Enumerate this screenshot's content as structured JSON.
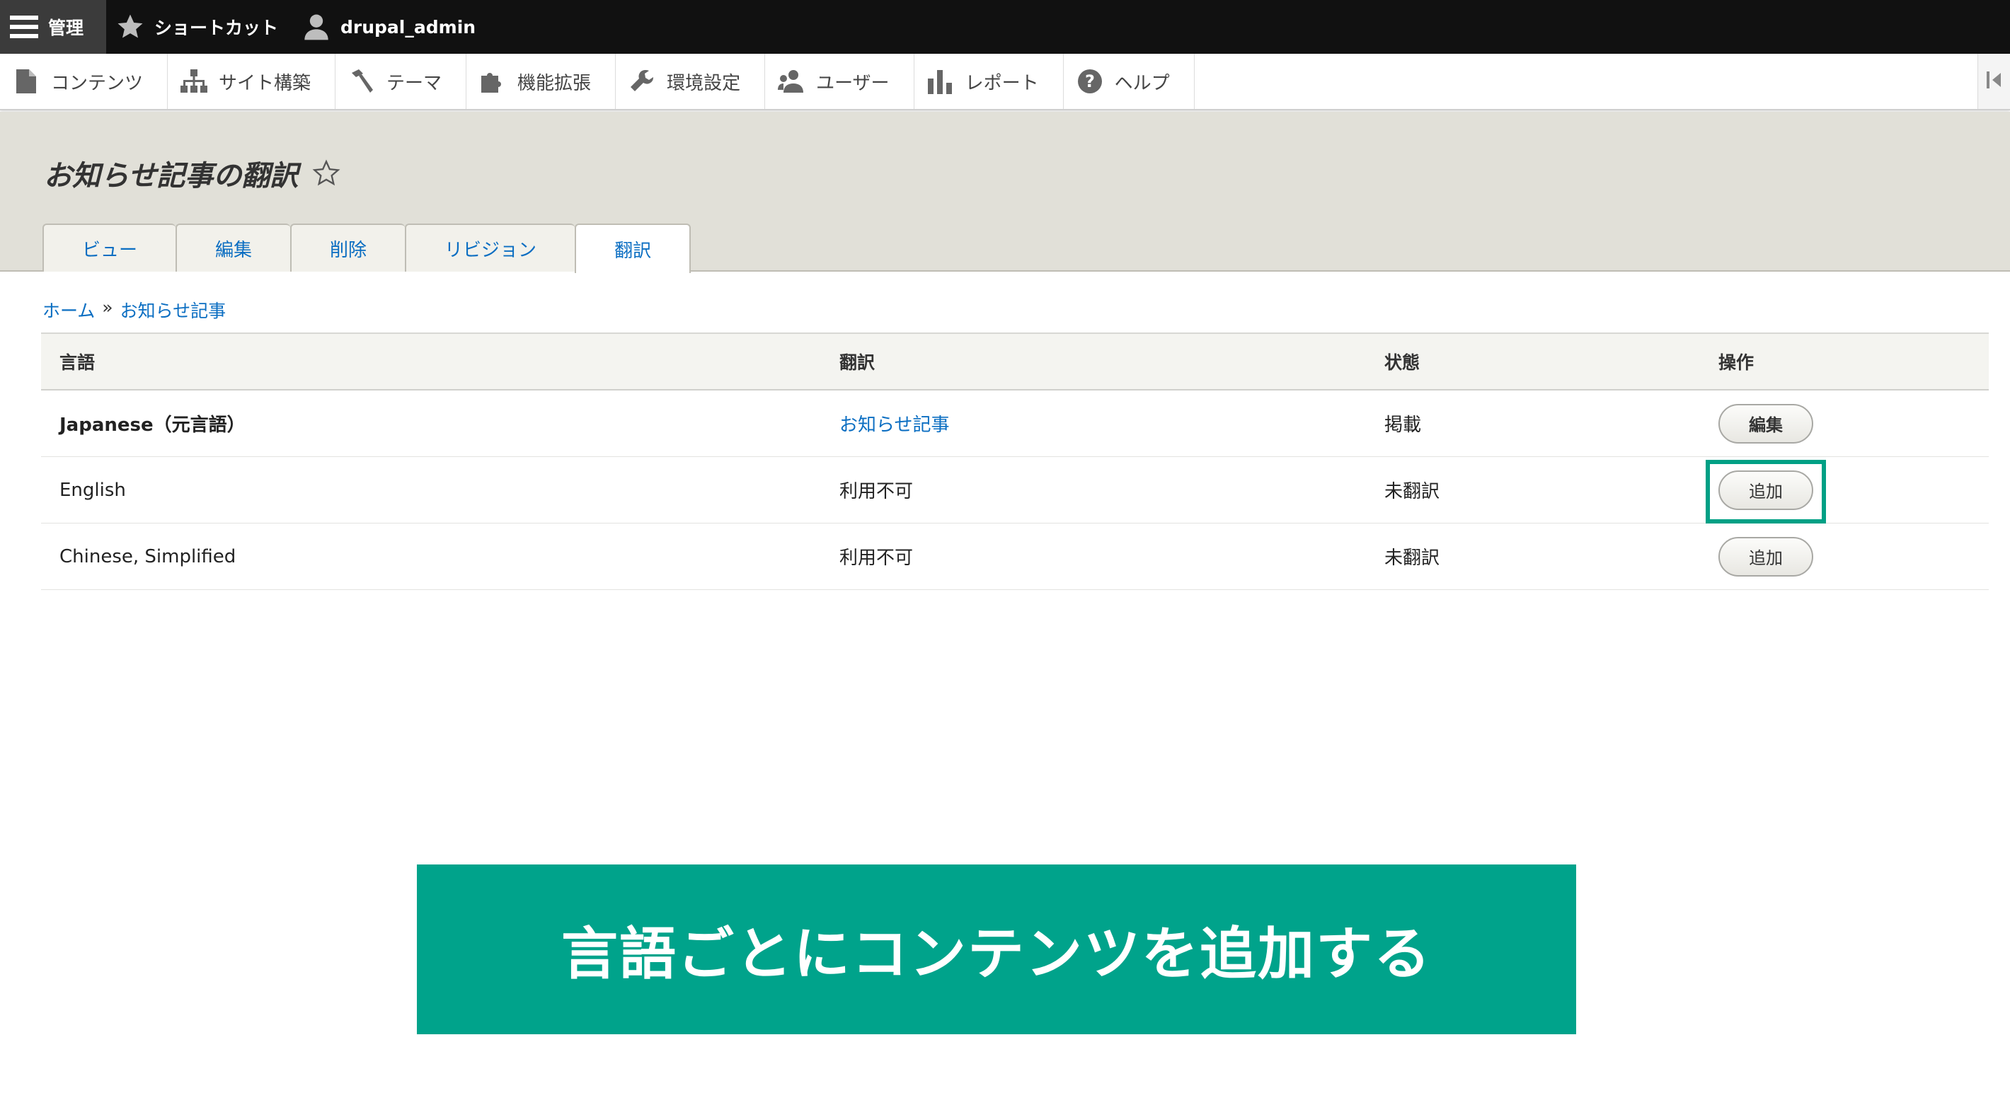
{
  "toolbar": {
    "manage_label": "管理",
    "shortcuts_label": "ショートカット",
    "user_label": "drupal_admin"
  },
  "menu": {
    "items": [
      {
        "label": "コンテンツ",
        "icon": "file-icon"
      },
      {
        "label": "サイト構築",
        "icon": "sitemap-icon"
      },
      {
        "label": "テーマ",
        "icon": "paint-icon"
      },
      {
        "label": "機能拡張",
        "icon": "puzzle-icon"
      },
      {
        "label": "環境設定",
        "icon": "wrench-icon"
      },
      {
        "label": "ユーザー",
        "icon": "people-icon"
      },
      {
        "label": "レポート",
        "icon": "bar-chart-icon"
      },
      {
        "label": "ヘルプ",
        "icon": "help-icon"
      }
    ]
  },
  "page": {
    "title": "お知らせ記事の翻訳",
    "tabs": [
      {
        "label": "ビュー",
        "active": false
      },
      {
        "label": "編集",
        "active": false
      },
      {
        "label": "削除",
        "active": false
      },
      {
        "label": "リビジョン",
        "active": false
      },
      {
        "label": "翻訳",
        "active": true
      }
    ]
  },
  "breadcrumb": {
    "home": "ホーム",
    "separator": "»",
    "current": "お知らせ記事"
  },
  "table": {
    "headers": [
      "言語",
      "翻訳",
      "状態",
      "操作"
    ],
    "rows": [
      {
        "language": "Japanese（元言語）",
        "translation": "お知らせ記事",
        "status": "掲載",
        "operation": "編集"
      },
      {
        "language": "English",
        "translation": "利用不可",
        "status": "未翻訳",
        "operation": "追加"
      },
      {
        "language": "Chinese, Simplified",
        "translation": "利用不可",
        "status": "未翻訳",
        "operation": "追加"
      }
    ]
  },
  "banner": {
    "text": "言語ごとにコンテンツを追加する"
  },
  "colors": {
    "accent": "#00a38b",
    "link": "#0b6ec2",
    "toolbar_bg": "#111111",
    "header_bg": "#e1e0d8"
  }
}
